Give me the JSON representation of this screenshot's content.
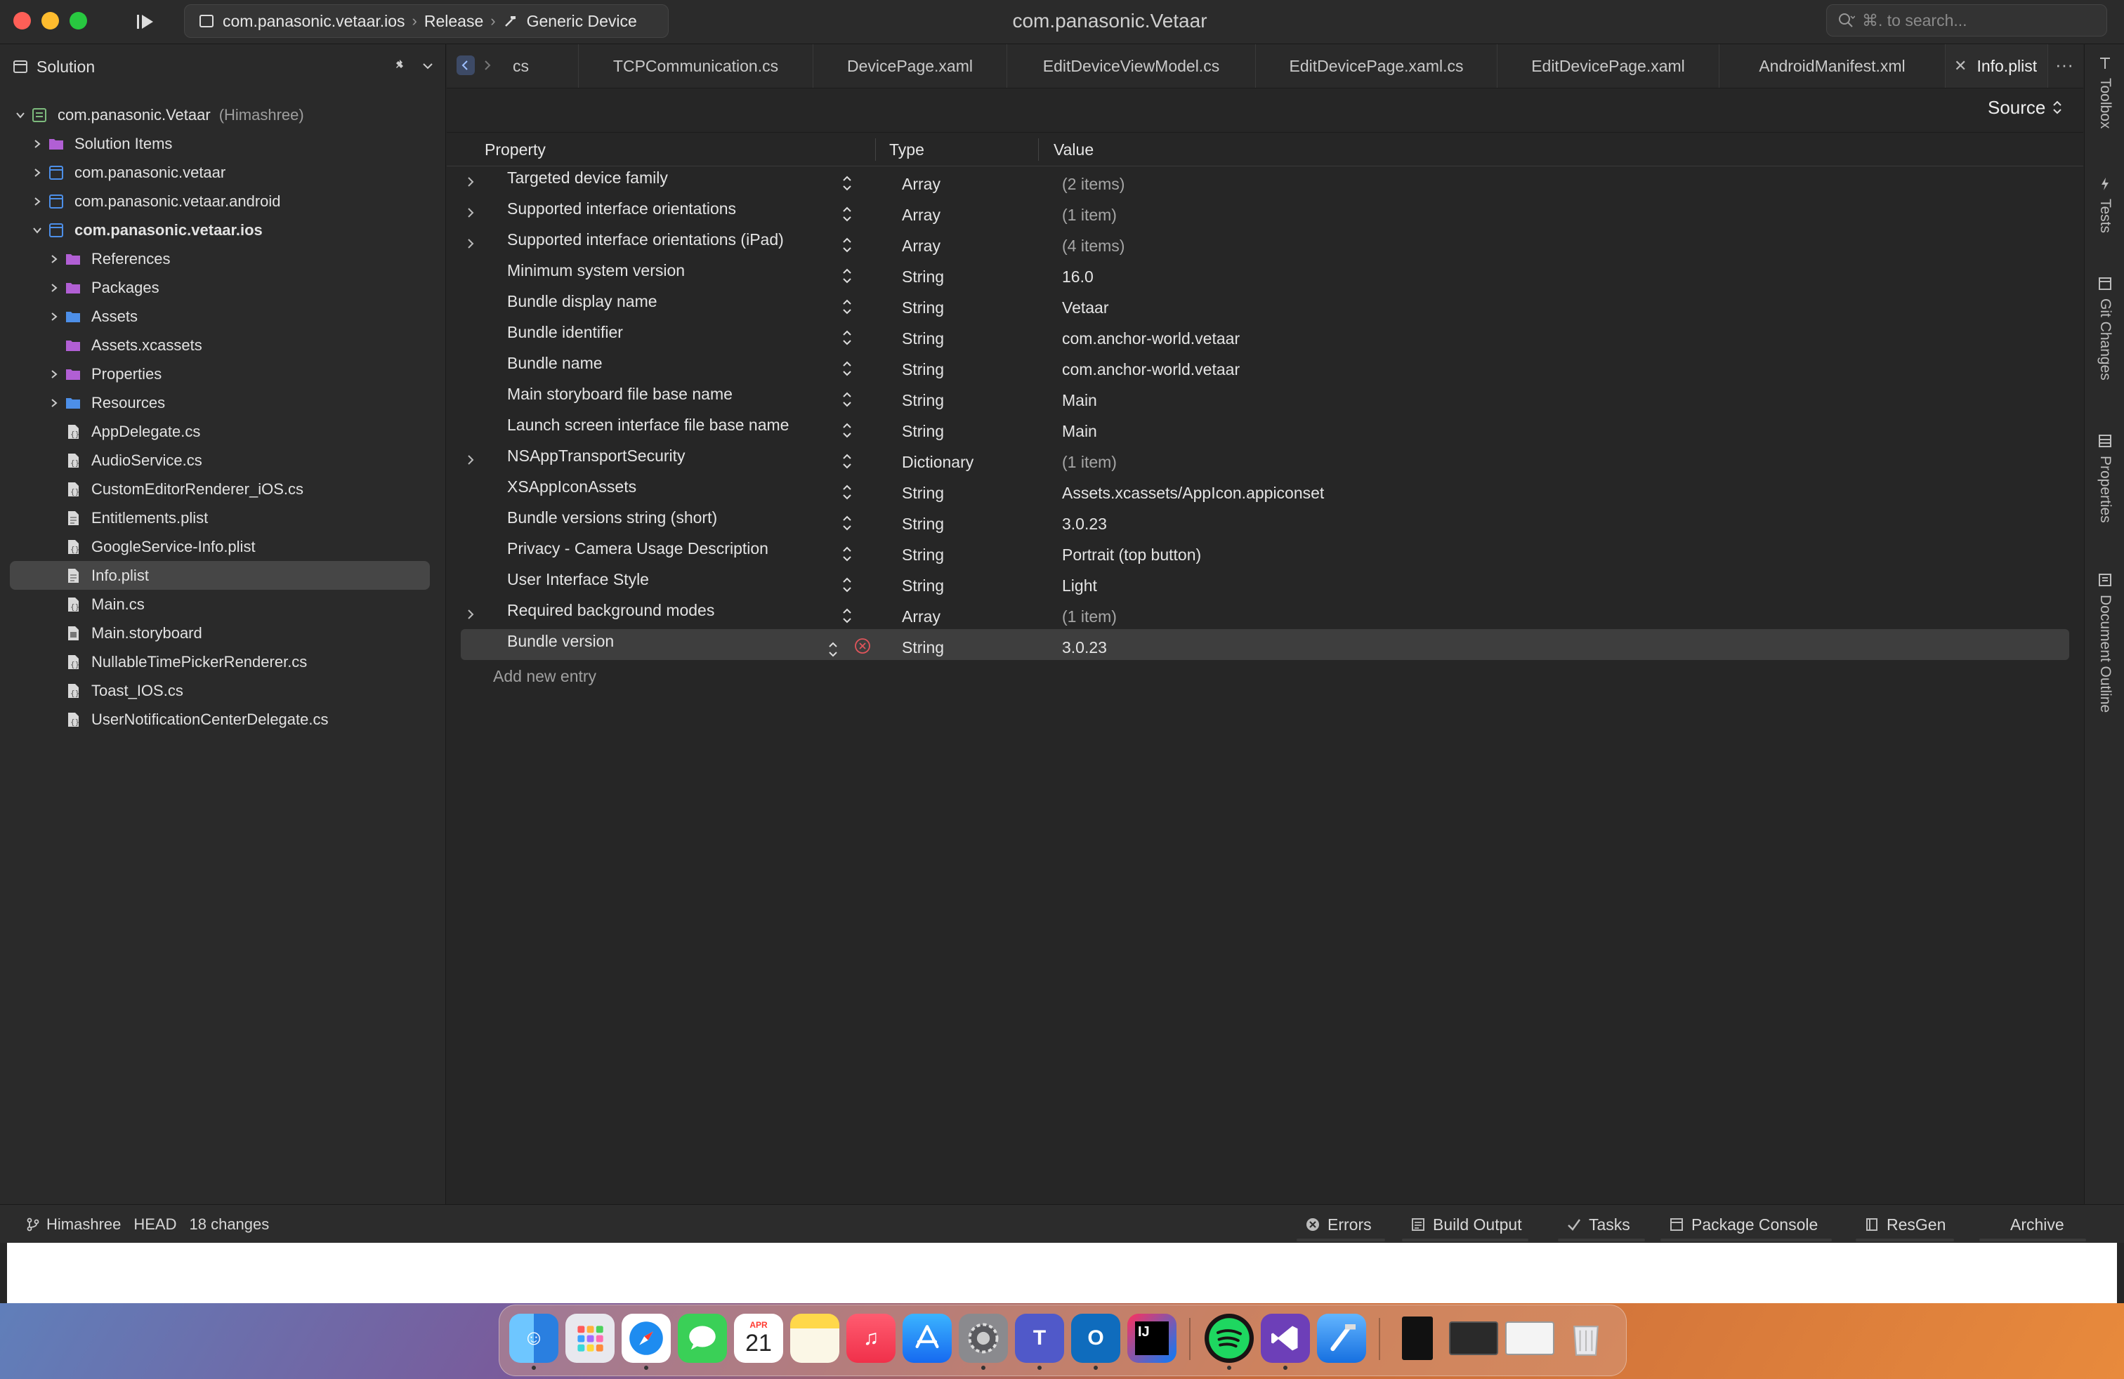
{
  "titlebar": {
    "breadcrumb": [
      "com.panasonic.vetaar.ios",
      "Release",
      "Generic Device"
    ],
    "app_title": "com.panasonic.Vetaar",
    "search_placeholder": "⌘. to search..."
  },
  "sidebar": {
    "title": "Solution",
    "solution": {
      "label": "com.panasonic.Vetaar",
      "owner": "(Himashree)"
    },
    "items": [
      {
        "label": "Solution Items",
        "level": 1,
        "arrow": "right",
        "icon": "solution-folder-icon"
      },
      {
        "label": "com.panasonic.vetaar",
        "level": 1,
        "arrow": "right",
        "icon": "project-icon"
      },
      {
        "label": "com.panasonic.vetaar.android",
        "level": 1,
        "arrow": "right",
        "icon": "project-icon"
      },
      {
        "label": "com.panasonic.vetaar.ios",
        "level": 1,
        "arrow": "down",
        "icon": "project-icon",
        "bold": true
      },
      {
        "label": "References",
        "level": 2,
        "arrow": "right",
        "icon": "references-folder-icon"
      },
      {
        "label": "Packages",
        "level": 2,
        "arrow": "right",
        "icon": "packages-folder-icon"
      },
      {
        "label": "Assets",
        "level": 2,
        "arrow": "right",
        "icon": "folder-icon"
      },
      {
        "label": "Assets.xcassets",
        "level": 2,
        "arrow": "none",
        "icon": "xcassets-icon"
      },
      {
        "label": "Properties",
        "level": 2,
        "arrow": "right",
        "icon": "properties-folder-icon"
      },
      {
        "label": "Resources",
        "level": 2,
        "arrow": "right",
        "icon": "folder-icon"
      },
      {
        "label": "AppDelegate.cs",
        "level": 2,
        "arrow": "none",
        "icon": "csharp-file-icon"
      },
      {
        "label": "AudioService.cs",
        "level": 2,
        "arrow": "none",
        "icon": "csharp-file-icon"
      },
      {
        "label": "CustomEditorRenderer_iOS.cs",
        "level": 2,
        "arrow": "none",
        "icon": "csharp-file-icon"
      },
      {
        "label": "Entitlements.plist",
        "level": 2,
        "arrow": "none",
        "icon": "plist-file-icon"
      },
      {
        "label": "GoogleService-Info.plist",
        "level": 2,
        "arrow": "none",
        "icon": "csharp-file-icon"
      },
      {
        "label": "Info.plist",
        "level": 2,
        "arrow": "none",
        "icon": "plist-file-icon",
        "selected": true
      },
      {
        "label": "Main.cs",
        "level": 2,
        "arrow": "none",
        "icon": "csharp-file-icon"
      },
      {
        "label": "Main.storyboard",
        "level": 2,
        "arrow": "none",
        "icon": "storyboard-file-icon"
      },
      {
        "label": "NullableTimePickerRenderer.cs",
        "level": 2,
        "arrow": "none",
        "icon": "csharp-file-icon"
      },
      {
        "label": "Toast_IOS.cs",
        "level": 2,
        "arrow": "none",
        "icon": "csharp-file-icon"
      },
      {
        "label": "UserNotificationCenterDelegate.cs",
        "level": 2,
        "arrow": "none",
        "icon": "csharp-file-icon"
      }
    ]
  },
  "tabs": [
    {
      "label": "cs"
    },
    {
      "label": "TCPCommunication.cs"
    },
    {
      "label": "DevicePage.xaml"
    },
    {
      "label": "EditDeviceViewModel.cs"
    },
    {
      "label": "EditDevicePage.xaml.cs"
    },
    {
      "label": "EditDevicePage.xaml"
    },
    {
      "label": "AndroidManifest.xml"
    },
    {
      "label": "Info.plist",
      "active": true
    }
  ],
  "editor": {
    "source_label": "Source",
    "columns": {
      "property": "Property",
      "type": "Type",
      "value": "Value"
    },
    "rows": [
      {
        "property": "Targeted device family",
        "type": "Array",
        "value": "(2 items)",
        "expandable": true
      },
      {
        "property": "Supported interface orientations",
        "type": "Array",
        "value": "(1 item)",
        "expandable": true
      },
      {
        "property": "Supported interface orientations (iPad)",
        "type": "Array",
        "value": "(4 items)",
        "expandable": true
      },
      {
        "property": "Minimum system version",
        "type": "String",
        "value": "16.0",
        "expandable": false
      },
      {
        "property": "Bundle display name",
        "type": "String",
        "value": "Vetaar",
        "expandable": false
      },
      {
        "property": "Bundle identifier",
        "type": "String",
        "value": "com.anchor-world.vetaar",
        "expandable": false
      },
      {
        "property": "Bundle name",
        "type": "String",
        "value": "com.anchor-world.vetaar",
        "expandable": false
      },
      {
        "property": "Main storyboard file base name",
        "type": "String",
        "value": "Main",
        "expandable": false
      },
      {
        "property": "Launch screen interface file base name",
        "type": "String",
        "value": "Main",
        "expandable": false
      },
      {
        "property": "NSAppTransportSecurity",
        "type": "Dictionary",
        "value": "(1 item)",
        "expandable": true
      },
      {
        "property": "XSAppIconAssets",
        "type": "String",
        "value": "Assets.xcassets/AppIcon.appiconset",
        "expandable": false
      },
      {
        "property": "Bundle versions string (short)",
        "type": "String",
        "value": "3.0.23",
        "expandable": false
      },
      {
        "property": "Privacy - Camera Usage Description",
        "type": "String",
        "value": "Portrait (top button)",
        "expandable": false
      },
      {
        "property": "User Interface Style",
        "type": "String",
        "value": "Light",
        "expandable": false
      },
      {
        "property": "Required background modes",
        "type": "Array",
        "value": "(1 item)",
        "expandable": true
      },
      {
        "property": "Bundle version",
        "type": "String",
        "value": "3.0.23",
        "expandable": false,
        "selected": true
      }
    ],
    "add_entry": "Add new entry"
  },
  "right_rail": [
    "Toolbox",
    "Tests",
    "Git Changes",
    "Properties",
    "Document Outline"
  ],
  "statusbar": {
    "user": "Himashree",
    "branch": "HEAD",
    "changes": "18 changes",
    "pads": [
      "Errors",
      "Build Output",
      "Tasks",
      "Package Console",
      "ResGen",
      "Archive"
    ]
  },
  "dock": {
    "calendar_month": "APR",
    "calendar_day": "21",
    "apps": [
      "finder-icon",
      "launchpad-icon",
      "safari-icon",
      "messages-icon",
      "calendar-icon",
      "notes-icon",
      "music-icon",
      "app-store-icon",
      "system-settings-icon",
      "teams-icon",
      "outlook-icon",
      "intellij-icon",
      "spotify-icon",
      "visual-studio-icon",
      "xcode-icon",
      "document-icon",
      "screen-icon",
      "preview-icon",
      "trash-icon"
    ]
  },
  "colors": {
    "accent_traffic_red": "#ff5f57",
    "accent_traffic_yellow": "#febc2e",
    "accent_traffic_green": "#28c840",
    "folder_blue": "#4d8fe8",
    "folder_purple": "#b15fd4",
    "error_red": "#e0555b"
  }
}
